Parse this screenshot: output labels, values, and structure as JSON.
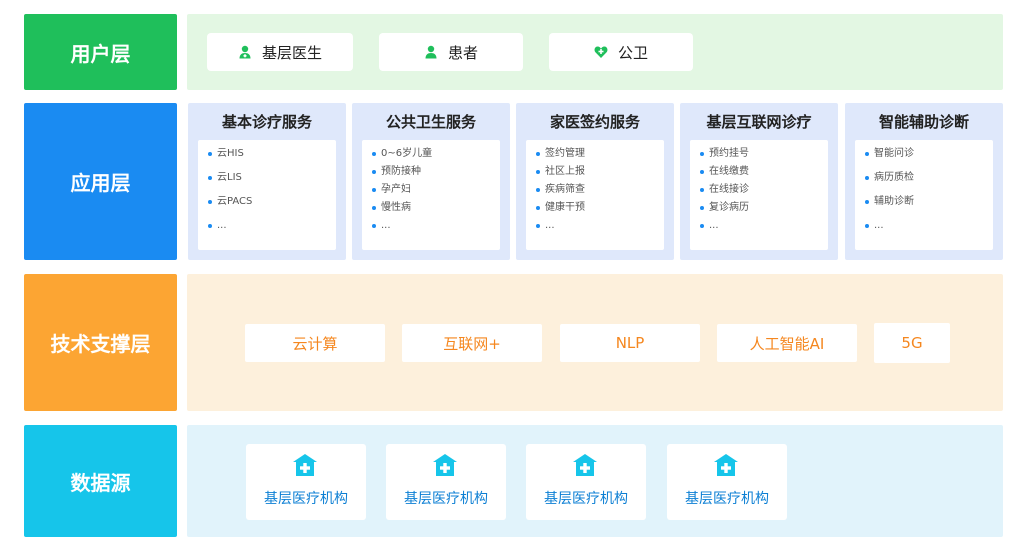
{
  "colors": {
    "user": "#1fbf5b",
    "app": "#1a8bf2",
    "tech": "#fca533",
    "data": "#16c5ea"
  },
  "user_layer": {
    "label": "用户层",
    "cards": [
      {
        "label": "基层医生",
        "icon": "doctor-icon"
      },
      {
        "label": "患者",
        "icon": "patient-icon"
      },
      {
        "label": "公卫",
        "icon": "heart-plus-icon"
      }
    ]
  },
  "app_layer": {
    "label": "应用层",
    "columns": [
      {
        "title": "基本诊疗服务",
        "items": [
          "云HIS",
          "云LIS",
          "云PACS",
          "..."
        ]
      },
      {
        "title": "公共卫生服务",
        "items": [
          "0~6岁儿童",
          "预防接种",
          "孕产妇",
          "慢性病",
          "..."
        ]
      },
      {
        "title": "家医签约服务",
        "items": [
          "签约管理",
          "社区上报",
          "疾病筛查",
          "健康干预",
          "..."
        ]
      },
      {
        "title": "基层互联网诊疗",
        "items": [
          "预约挂号",
          "在线缴费",
          "在线接诊",
          "复诊病历",
          "..."
        ]
      },
      {
        "title": "智能辅助诊断",
        "items": [
          "智能问诊",
          "病历质检",
          "辅助诊断",
          "..."
        ]
      }
    ]
  },
  "tech_layer": {
    "label": "技术支撑层",
    "items": [
      "云计算",
      "互联网+",
      "NLP",
      "人工智能AI",
      "5G"
    ]
  },
  "data_layer": {
    "label": "数据源",
    "icon": "hospital-icon",
    "items": [
      "基层医疗机构",
      "基层医疗机构",
      "基层医疗机构",
      "基层医疗机构"
    ]
  }
}
